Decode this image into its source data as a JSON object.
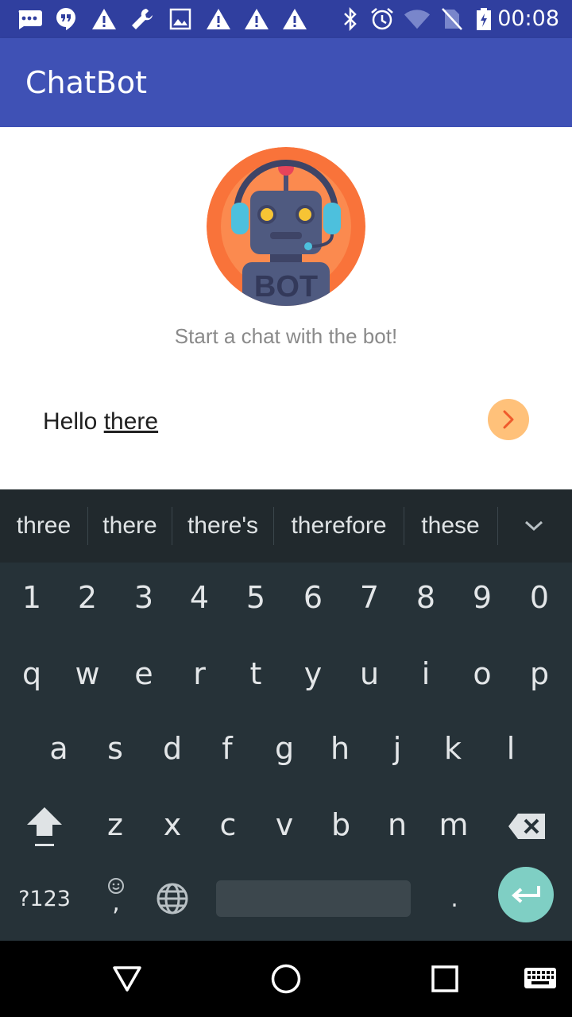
{
  "status_bar": {
    "time": "00:08",
    "left_icons": [
      "messaging-icon",
      "hangouts-icon",
      "warning-icon",
      "wrench-icon",
      "image-icon",
      "warning-icon",
      "warning-icon",
      "warning-icon"
    ],
    "right_icons": [
      "bluetooth-icon",
      "alarm-icon",
      "wifi-icon",
      "no-sim-icon",
      "battery-charging-icon"
    ]
  },
  "app_bar": {
    "title": "ChatBot"
  },
  "content": {
    "avatar_label": "BOT",
    "welcome_text": "Start a chat with the bot!",
    "input": {
      "text_plain": "Hello ",
      "text_underlined": "there"
    }
  },
  "keyboard": {
    "suggestions": [
      "three",
      "there",
      "there's",
      "therefore",
      "these"
    ],
    "row_numbers": [
      "1",
      "2",
      "3",
      "4",
      "5",
      "6",
      "7",
      "8",
      "9",
      "0"
    ],
    "row_1": [
      "q",
      "w",
      "e",
      "r",
      "t",
      "y",
      "u",
      "i",
      "o",
      "p"
    ],
    "row_2": [
      "a",
      "s",
      "d",
      "f",
      "g",
      "h",
      "j",
      "k",
      "l"
    ],
    "row_3": [
      "z",
      "x",
      "c",
      "v",
      "b",
      "n",
      "m"
    ],
    "symbols_key": "?123",
    "comma_key": ",",
    "period_key": "."
  },
  "colors": {
    "status_bar": "#303f9f",
    "app_bar": "#3f51b5",
    "send_button": "#ffc17a",
    "send_chevron": "#ef5a2c",
    "keyboard_bg": "#263238",
    "enter_key": "#7fcfc4"
  }
}
